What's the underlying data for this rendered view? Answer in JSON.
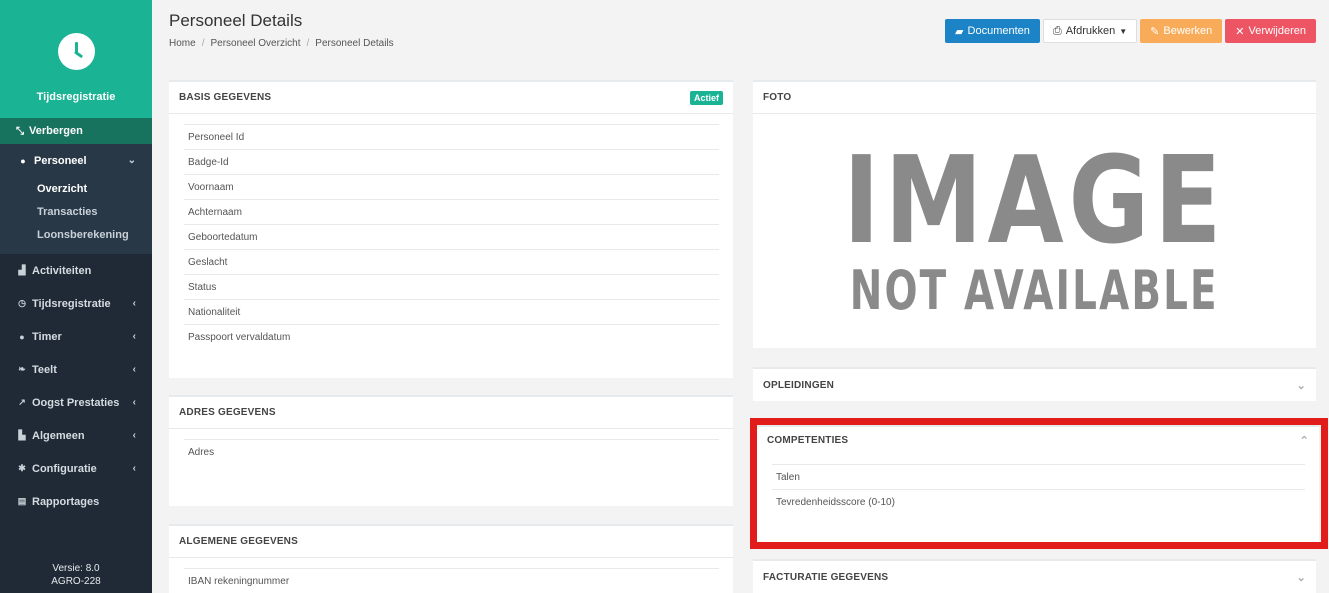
{
  "brand": {
    "title": "Tijdsregistratie",
    "icon": "clock-icon"
  },
  "sidebar": {
    "hide_label": "Verbergen",
    "group": {
      "label": "Personeel",
      "items": [
        {
          "label": "Overzicht"
        },
        {
          "label": "Transacties"
        },
        {
          "label": "Loonsberekening"
        }
      ]
    },
    "items": [
      {
        "label": "Activiteiten",
        "icon": "activity-icon"
      },
      {
        "label": "Tijdsregistratie",
        "icon": "clock-icon"
      },
      {
        "label": "Timer",
        "icon": "timer-icon"
      },
      {
        "label": "Teelt",
        "icon": "leaf-icon"
      },
      {
        "label": "Oogst Prestaties",
        "icon": "line-chart-icon"
      },
      {
        "label": "Algemeen",
        "icon": "bar-chart-icon"
      },
      {
        "label": "Configuratie",
        "icon": "gear-icon"
      },
      {
        "label": "Rapportages",
        "icon": "document-icon"
      }
    ],
    "version_line1": "Versie: 8.0",
    "version_line2": "AGRO-228"
  },
  "header": {
    "title": "Personeel Details",
    "breadcrumb": [
      "Home",
      "Personeel Overzicht",
      "Personeel Details"
    ],
    "buttons": {
      "documents": "Documenten",
      "print": "Afdrukken",
      "edit": "Bewerken",
      "delete": "Verwijderen"
    }
  },
  "basis": {
    "title": "BASIS GEGEVENS",
    "badge": "Actief",
    "rows": [
      "Personeel Id",
      "Badge-Id",
      "Voornaam",
      "Achternaam",
      "Geboortedatum",
      "Geslacht",
      "Status",
      "Nationaliteit",
      "Passpoort vervaldatum"
    ]
  },
  "adres": {
    "title": "ADRES GEGEVENS",
    "rows": [
      "Adres"
    ]
  },
  "algemene": {
    "title": "ALGEMENE GEGEVENS",
    "rows": [
      "IBAN rekeningnummer"
    ]
  },
  "foto": {
    "title": "FOTO",
    "image_text_big": "IMAGE",
    "image_text_small": "NOT AVAILABLE"
  },
  "opleidingen": {
    "title": "OPLEIDINGEN"
  },
  "competenties": {
    "title": "COMPETENTIES",
    "rows": [
      "Talen",
      "Tevredenheidsscore (0-10)"
    ]
  },
  "facturatie": {
    "title": "FACTURATIE GEGEVENS"
  },
  "colors": {
    "accent": "#1ab394",
    "sidebar": "#1f2a36",
    "highlight": "#e21b1b"
  }
}
